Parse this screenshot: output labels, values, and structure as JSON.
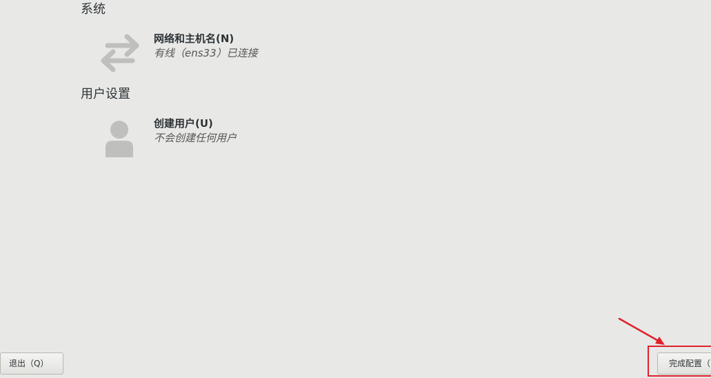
{
  "sections": {
    "system": {
      "heading": "系统",
      "network_spoke": {
        "title": "网络和主机名(N)",
        "status": "有线（ens33）已连接",
        "icon": "network-arrows-icon"
      }
    },
    "user_settings": {
      "heading": "用户设置",
      "user_spoke": {
        "title": "创建用户(U)",
        "status": "不会创建任何用户",
        "icon": "user-avatar-icon"
      }
    }
  },
  "footer": {
    "quit_label": "退出（Q）",
    "finish_label": "完成配置（F）"
  },
  "annotations": {
    "highlight_color": "#e0202a"
  }
}
